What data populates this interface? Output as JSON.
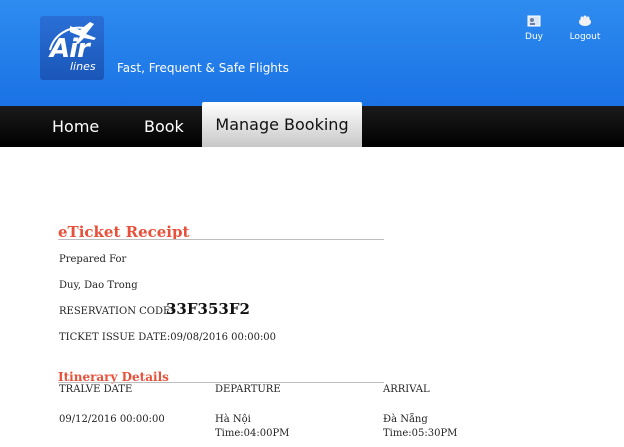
{
  "header": {
    "logo_text": "Air",
    "logo_sub": "lines",
    "tagline": "Fast, Frequent & Safe Flights",
    "user_label": "Duy",
    "logout_label": "Logout"
  },
  "nav": {
    "items": [
      "Home",
      "Book",
      "Manage Booking"
    ],
    "active": "Manage Booking"
  },
  "receipt": {
    "title": "eTicket Receipt",
    "prepared_for_label": "Prepared For",
    "passenger_name": "Duy, Dao Trong",
    "reservation_label": "RESERVATION CODE:",
    "reservation_code": "33F353F2",
    "issue_date": "TICKET ISSUE DATE:09/08/2016 00:00:00"
  },
  "itinerary": {
    "title": "Itinerary Details",
    "headers": [
      "TRALVE DATE",
      "DEPARTURE",
      "ARRIVAL"
    ],
    "row": {
      "date": "09/12/2016 00:00:00",
      "departure_city": "Hà Nội",
      "departure_time": "Time:04:00PM",
      "arrival_city": "Đà Nẵng",
      "arrival_time": "Time:05:30PM"
    }
  },
  "colors": {
    "header_blue": "#1a72e4",
    "accent": "#e9503a",
    "nav_bg": "#000000"
  },
  "icons": [
    "airplane-icon",
    "user-icon",
    "logout-icon"
  ]
}
